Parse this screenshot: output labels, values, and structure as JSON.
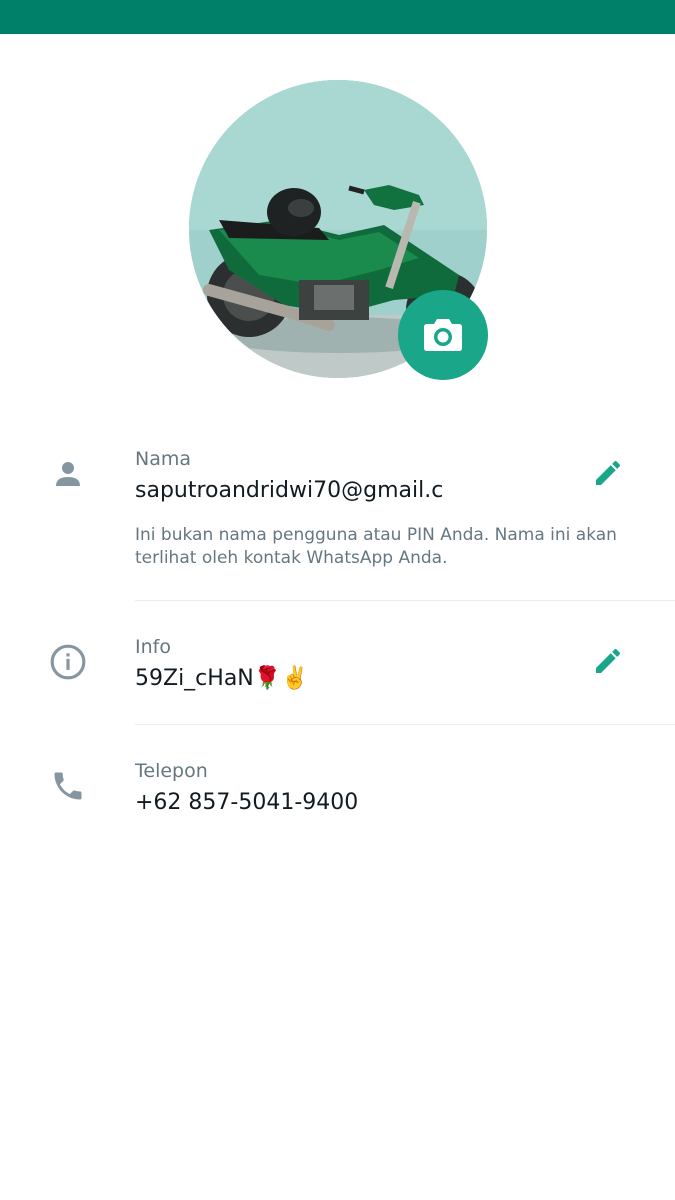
{
  "profile": {
    "photo_alt": "profile photo",
    "camera_icon": "camera-icon"
  },
  "name_row": {
    "icon": "person-icon",
    "label": "Nama",
    "value": "saputroandridwi70@gmail.c",
    "help_text": "Ini bukan nama pengguna atau PIN Anda. Nama ini akan terlihat oleh kontak WhatsApp Anda.",
    "edit_icon": "pencil-icon"
  },
  "info_row": {
    "icon": "info-icon",
    "label": "Info",
    "value": "59Zi_cHaN🌹✌️",
    "edit_icon": "pencil-icon"
  },
  "phone_row": {
    "icon": "phone-icon",
    "label": "Telepon",
    "value": "+62 857-5041-9400"
  },
  "colors": {
    "header": "#008069",
    "accent": "#1aa688",
    "icon_gray": "#8696a0",
    "label_gray": "#667781",
    "text_primary": "#111b21"
  }
}
